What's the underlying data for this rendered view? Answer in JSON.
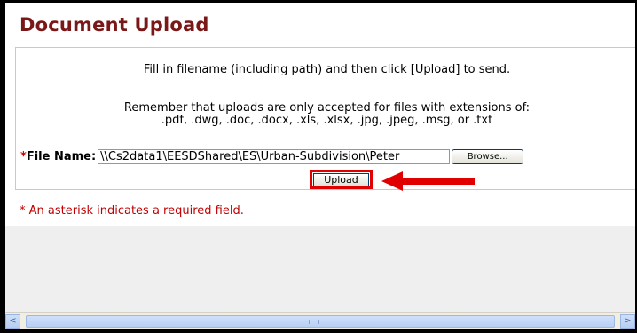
{
  "page": {
    "title": "Document Upload",
    "instruction_line1": "Fill in filename (including path) and then click [Upload] to send.",
    "instruction_line2": "Remember that uploads are only accepted for files with extensions of:",
    "instruction_line3": ".pdf, .dwg, .doc, .docx, .xls, .xlsx, .jpg, .jpeg, .msg, or .txt",
    "required_marker": "*",
    "file_label": "File Name:",
    "file_value": "\\\\Cs2data1\\EESDShared\\ES\\Urban-Subdivision\\Peter",
    "browse_label": "Browse...",
    "upload_label": "Upload",
    "required_note": "* An asterisk indicates a required field."
  },
  "scrollbar": {
    "left_arrow": "<",
    "right_arrow": ">"
  },
  "colors": {
    "title": "#7a1717",
    "required": "#c00000",
    "highlight": "#e00000",
    "gray_area": "#efefef"
  }
}
